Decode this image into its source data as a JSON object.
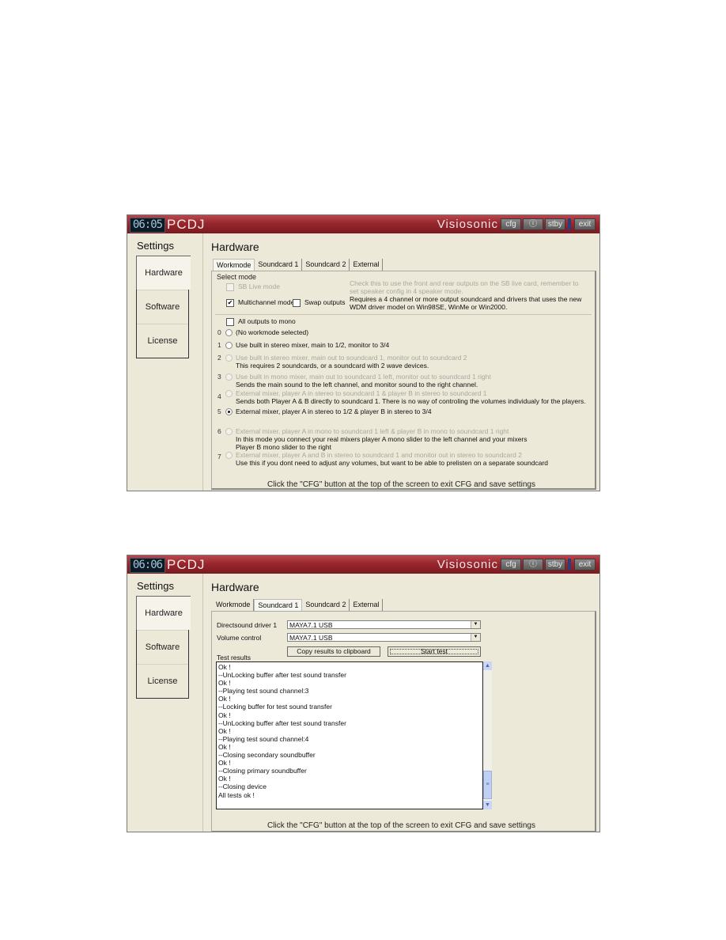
{
  "windows": [
    {
      "clock": "06:05",
      "app_name": "PCDJ",
      "brand": "Visiosonic",
      "titlebar_buttons": {
        "cfg": "cfg",
        "info": "ⓘ",
        "stby": "stby",
        "exit": "exit"
      },
      "sidebar": {
        "title": "Settings",
        "items": [
          {
            "label": "Hardware",
            "active": true
          },
          {
            "label": "Software"
          },
          {
            "label": "License"
          }
        ]
      },
      "page_title": "Hardware",
      "tabs": [
        {
          "label": "Workmode",
          "active": true
        },
        {
          "label": "Soundcard 1"
        },
        {
          "label": "Soundcard 2"
        },
        {
          "label": "External"
        }
      ],
      "workmode": {
        "group_label": "Select mode",
        "sb_live": {
          "label": "SB Live mode",
          "checked": false,
          "enabled": false
        },
        "sb_live_hint": [
          "Check this to use the front and rear outputs on the SB live card, remember to",
          "set speaker config in 4 speaker mode."
        ],
        "multichannel": {
          "label": "Multichannel mode",
          "checked": true
        },
        "swap_outputs": {
          "label": "Swap outputs",
          "checked": false
        },
        "multichannel_hint": [
          "Requires a 4 channel or more output soundcard and drivers that uses the new",
          "WDM driver model on Win98SE, WinMe or Win2000."
        ],
        "all_mono": {
          "label": "All outputs to mono",
          "checked": false
        },
        "modes": [
          {
            "num": "0",
            "label": "(No workmode selected)",
            "enabled": true,
            "selected": false,
            "desc": []
          },
          {
            "num": "1",
            "label": "Use built in stereo mixer, main to 1/2, monitor to 3/4",
            "enabled": true,
            "selected": false,
            "desc": []
          },
          {
            "num": "2",
            "label": "Use built in stereo mixer, main out to soundcard 1, monitor out to soundcard 2",
            "enabled": false,
            "selected": false,
            "desc": [
              "This requires 2 soundcards, or a soundcard with 2 wave devices."
            ]
          },
          {
            "num": "3",
            "label": "Use built in mono mixer, main out to soundcard 1 left, monitor out to soundcard 1 right",
            "enabled": false,
            "selected": false,
            "desc": [
              "Sends the main sound to the left channel, and monitor sound to the right channel."
            ]
          },
          {
            "num": "4",
            "label": "External mixer, player A in stereo to soundcard 1 & player B in stereo to soundcard 1",
            "enabled": false,
            "selected": false,
            "desc": [
              "Sends both Player A & B directly to soundcard 1. There is no way of controling the volumes individualy for the players."
            ]
          },
          {
            "num": "5",
            "label": "External mixer, player A in stereo to 1/2 & player B in stereo to 3/4",
            "enabled": true,
            "selected": true,
            "desc": []
          },
          {
            "num": "6",
            "label": "External mixer, player A in mono to soundcard 1 left & player B in mono to soundcard 1 right",
            "enabled": false,
            "selected": false,
            "desc": [
              "In this mode you connect your real mixers player A mono slider to the left channel and your mixers",
              "Player B mono slider to the right"
            ]
          },
          {
            "num": "7",
            "label": "External mixer, player A and B in stereo to soundcard 1 and monitor out in stereo to soundcard 2",
            "enabled": false,
            "selected": false,
            "desc": [
              "Use this if you dont need to adjust any volumes, but want to be able to prelisten on a separate soundcard"
            ]
          }
        ]
      },
      "footer": "Click the \"CFG\" button at the top of the screen to exit CFG and save settings"
    },
    {
      "clock": "06:06",
      "app_name": "PCDJ",
      "brand": "Visiosonic",
      "titlebar_buttons": {
        "cfg": "cfg",
        "info": "ⓘ",
        "stby": "stby",
        "exit": "exit"
      },
      "sidebar": {
        "title": "Settings",
        "items": [
          {
            "label": "Hardware",
            "active": true
          },
          {
            "label": "Software"
          },
          {
            "label": "License"
          }
        ]
      },
      "page_title": "Hardware",
      "tabs": [
        {
          "label": "Workmode"
        },
        {
          "label": "Soundcard 1",
          "active": true
        },
        {
          "label": "Soundcard 2"
        },
        {
          "label": "External"
        }
      ],
      "soundcard": {
        "driver_label": "Directsound driver 1",
        "driver_value": "MAYA7.1 USB",
        "volume_label": "Volume control",
        "volume_value": "MAYA7.1 USB",
        "copy_button": "Copy results to clipboard",
        "start_button": "Start test",
        "results_label": "Test results",
        "results_lines": [
          "Ok !",
          "--UnLocking buffer after test sound transfer",
          "Ok !",
          "--Playing test sound channel:3",
          "Ok !",
          "--Locking buffer for test sound transfer",
          "Ok !",
          "--UnLocking buffer after test sound transfer",
          "Ok !",
          "--Playing test sound channel:4",
          "Ok !",
          "--Closing secondary soundbuffer",
          "Ok !",
          "--Closing primary soundbuffer",
          "Ok !",
          "--Closing device",
          "All tests ok !"
        ]
      },
      "footer": "Click the \"CFG\" button at the top of the screen to exit CFG and save settings"
    }
  ]
}
